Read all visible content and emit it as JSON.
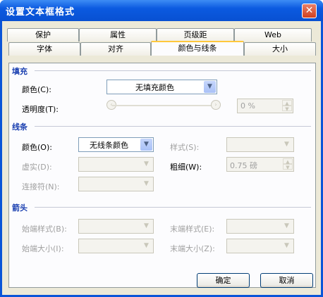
{
  "window": {
    "title": "设置文本框格式",
    "close_glyph": "✕"
  },
  "tabs": {
    "row_back": [
      "保护",
      "属性",
      "页级距",
      "Web"
    ],
    "row_front": [
      "字体",
      "对齐",
      "颜色与线条",
      "大小"
    ],
    "active": "颜色与线条"
  },
  "fill": {
    "section": "填充",
    "color_label": "颜色(C):",
    "color_value": "无填充颜色",
    "transparency_label": "透明度(T):",
    "slider_left_glyph": "‹",
    "slider_right_glyph": "›",
    "transparency_value": "0 %"
  },
  "line": {
    "section": "线条",
    "color_label": "颜色(O):",
    "color_value": "无线条颜色",
    "style_label": "样式(S):",
    "dashed_label": "虚实(D):",
    "weight_label": "粗细(W):",
    "weight_value": "0.75 磅",
    "connector_label": "连接符(N):"
  },
  "arrows": {
    "section": "箭头",
    "begin_style_label": "始端样式(B):",
    "end_style_label": "末端样式(E):",
    "begin_size_label": "始端大小(I):",
    "end_size_label": "末端大小(Z):"
  },
  "buttons": {
    "ok": "确定",
    "cancel": "取消"
  },
  "glyphs": {
    "dropdown": "▼",
    "spin_up": "▲",
    "spin_down": "▼"
  },
  "colors": {
    "titlebar": "#0b5ae0",
    "section_text": "#1a3fb0",
    "active_tab_highlight": "#ffc83c"
  }
}
